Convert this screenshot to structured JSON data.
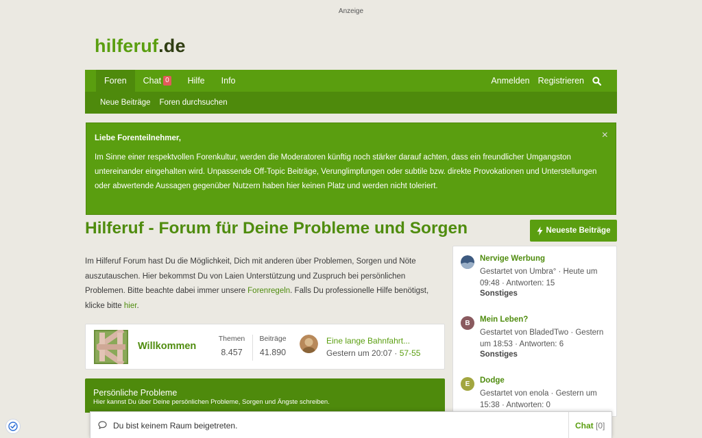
{
  "ad": {
    "label": "Anzeige"
  },
  "logo": {
    "part1": "hilferuf",
    "part2": ".de"
  },
  "nav": {
    "tabs": [
      {
        "label": "Foren"
      },
      {
        "label": "Chat",
        "badge": "0"
      },
      {
        "label": "Hilfe"
      },
      {
        "label": "Info"
      }
    ],
    "login": "Anmelden",
    "register": "Registrieren",
    "search_icon": "search-icon"
  },
  "subnav": {
    "items": [
      "Neue Beiträge",
      "Foren durchsuchen"
    ]
  },
  "notice": {
    "title": "Liebe Forenteilnehmer,",
    "text": "Im Sinne einer respektvollen Forenkultur, werden die Moderatoren künftig noch stärker darauf achten, dass ein freundlicher Umgangston untereinander eingehalten wird. Unpassende Off-Topic Beiträge, Verunglimpfungen oder subtile bzw. direkte Provokationen und Unterstellungen oder abwertende Aussagen gegenüber Nutzern haben hier keinen Platz und werden nicht toleriert.",
    "close": "×"
  },
  "page": {
    "title": "Hilferuf - Forum für Deine Probleme und Sorgen",
    "newest_button": "Neueste Beiträge",
    "intro": {
      "p1": "Im Hilferuf Forum hast Du die Möglichkeit, Dich mit anderen über Problemen, Sorgen und Nöte auszutauschen. Hier bekommst Du von Laien Unterstützung und Zuspruch bei persönlichen Problemen. Bitte beachte dabei immer unsere ",
      "link1": "Forenregeln",
      "p2": ". Falls Du professionelle Hilfe benötigst, klicke bitte ",
      "link2": "hier",
      "p3": "."
    }
  },
  "forum_card": {
    "name": "Willkommen",
    "themen_label": "Themen",
    "themen_value": "8.457",
    "beitraege_label": "Beiträge",
    "beitraege_value": "41.890",
    "last_title": "Eine lange Bahnfahrt...",
    "last_time": "Gestern um 20:07",
    "last_sep": " · ",
    "last_user": "57-55"
  },
  "category": {
    "title": "Persönliche Probleme",
    "desc": "Hier kannst Du über Deine persönlichen Probleme, Sorgen und Ängste schreiben."
  },
  "sidebar": {
    "items": [
      {
        "title": "Nervige Werbung",
        "meta": "Gestartet von Umbra° · Heute um 09:48 · Antworten: 15",
        "forum": "Sonstiges",
        "avatar_letter": "",
        "avatar_color": "#3d5a80"
      },
      {
        "title": "Mein Leben?",
        "meta": "Gestartet von BladedTwo · Gestern um 18:53 · Antworten: 6",
        "forum": "Sonstiges",
        "avatar_letter": "B",
        "avatar_color": "#8a5a5f"
      },
      {
        "title": "Dodge",
        "meta": "Gestartet von enola · Gestern um 15:38 · Antworten: 0",
        "forum": "",
        "avatar_letter": "E",
        "avatar_color": "#a2a640"
      }
    ]
  },
  "chatbar": {
    "status": "Du bist keinem Raum beigetreten.",
    "chat_label": "Chat",
    "chat_count": "[0]"
  }
}
